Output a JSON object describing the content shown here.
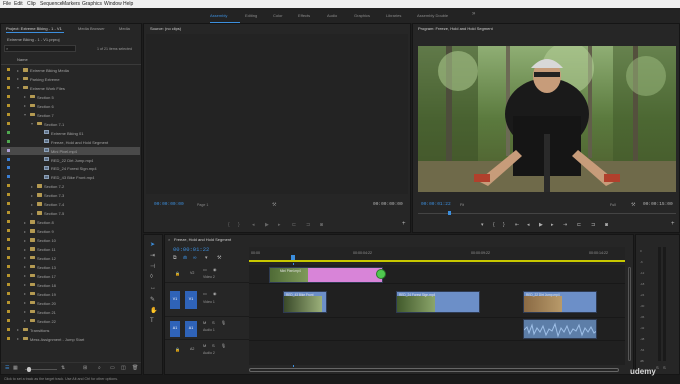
{
  "menu": [
    "File",
    "Edit",
    "Clip",
    "Sequence",
    "Markers",
    "Graphics",
    "Window",
    "Help"
  ],
  "workspaces": {
    "items": [
      "Assembly",
      "Editing",
      "Color",
      "Effects",
      "Audio",
      "Graphics",
      "Libraries",
      "Assembly Double"
    ],
    "active": "Assembly",
    "more": "»"
  },
  "project": {
    "tabs": [
      "Project: Extreme Biking - 1 - V1",
      "Media Browser",
      "Media"
    ],
    "name": "Extreme Biking - 1 - V1.prproj",
    "search_placeholder": "",
    "selection_info": "1 of 21 items selected",
    "column": "Name",
    "items": [
      {
        "label": "Extreme Biking Media",
        "type": "folder",
        "indent": 0,
        "color": "#b8962e",
        "twirl": "▸"
      },
      {
        "label": "Parking Extreme",
        "type": "folder",
        "indent": 0,
        "color": "#b8962e",
        "twirl": "▸"
      },
      {
        "label": "Extreme Work Files",
        "type": "folder",
        "indent": 0,
        "color": "#b8962e",
        "twirl": "▾"
      },
      {
        "label": "Section 5",
        "type": "folder",
        "indent": 1,
        "color": "#b8962e",
        "twirl": "▸"
      },
      {
        "label": "Section 6",
        "type": "folder",
        "indent": 1,
        "color": "#b8962e",
        "twirl": "▸"
      },
      {
        "label": "Section 7",
        "type": "folder",
        "indent": 1,
        "color": "#b8962e",
        "twirl": "▾"
      },
      {
        "label": "Section 7-1",
        "type": "folder",
        "indent": 2,
        "color": "#b8962e",
        "twirl": "▾"
      },
      {
        "label": "Extreme Biking 01",
        "type": "sequence",
        "indent": 3,
        "color": "#4fa84f",
        "twirl": ""
      },
      {
        "label": "Freeze, Hold and Hold Segment",
        "type": "sequence",
        "indent": 3,
        "color": "#4fa84f",
        "twirl": ""
      },
      {
        "label": "Mini Pixel.mp4",
        "type": "clip",
        "indent": 3,
        "color": "#b0a0d8",
        "twirl": "",
        "selected": true
      },
      {
        "label": "RED_22 Dirt Jump.mp4",
        "type": "clip",
        "indent": 3,
        "color": "#3b7fd4",
        "twirl": ""
      },
      {
        "label": "RED_24 Forest Sign.mp4",
        "type": "clip",
        "indent": 3,
        "color": "#3b7fd4",
        "twirl": ""
      },
      {
        "label": "RED_43 Bike Front.mp4",
        "type": "clip",
        "indent": 3,
        "color": "#3b7fd4",
        "twirl": ""
      },
      {
        "label": "Section 7-2",
        "type": "folder",
        "indent": 2,
        "color": "#b8962e",
        "twirl": "▸"
      },
      {
        "label": "Section 7-3",
        "type": "folder",
        "indent": 2,
        "color": "#b8962e",
        "twirl": "▸"
      },
      {
        "label": "Section 7-4",
        "type": "folder",
        "indent": 2,
        "color": "#b8962e",
        "twirl": "▸"
      },
      {
        "label": "Section 7-5",
        "type": "folder",
        "indent": 2,
        "color": "#b8962e",
        "twirl": "▸"
      },
      {
        "label": "Section 8",
        "type": "folder",
        "indent": 1,
        "color": "#b8962e",
        "twirl": "▸"
      },
      {
        "label": "Section 9",
        "type": "folder",
        "indent": 1,
        "color": "#b8962e",
        "twirl": "▸"
      },
      {
        "label": "Section 10",
        "type": "folder",
        "indent": 1,
        "color": "#b8962e",
        "twirl": "▸"
      },
      {
        "label": "Section 11",
        "type": "folder",
        "indent": 1,
        "color": "#b8962e",
        "twirl": "▸"
      },
      {
        "label": "Section 12",
        "type": "folder",
        "indent": 1,
        "color": "#b8962e",
        "twirl": "▸"
      },
      {
        "label": "Section 13",
        "type": "folder",
        "indent": 1,
        "color": "#b8962e",
        "twirl": "▸"
      },
      {
        "label": "Section 17",
        "type": "folder",
        "indent": 1,
        "color": "#b8962e",
        "twirl": "▸"
      },
      {
        "label": "Section 18",
        "type": "folder",
        "indent": 1,
        "color": "#b8962e",
        "twirl": "▸"
      },
      {
        "label": "Section 19",
        "type": "folder",
        "indent": 1,
        "color": "#b8962e",
        "twirl": "▸"
      },
      {
        "label": "Section 20",
        "type": "folder",
        "indent": 1,
        "color": "#b8962e",
        "twirl": "▸"
      },
      {
        "label": "Section 21",
        "type": "folder",
        "indent": 1,
        "color": "#b8962e",
        "twirl": "▸"
      },
      {
        "label": "Section 22",
        "type": "folder",
        "indent": 1,
        "color": "#b8962e",
        "twirl": "▸"
      },
      {
        "label": "Transitions",
        "type": "folder",
        "indent": 0,
        "color": "#b8962e",
        "twirl": "▸"
      },
      {
        "label": "Mess Assignment - Jump Start",
        "type": "folder",
        "indent": 0,
        "color": "#b8962e",
        "twirl": "▸"
      }
    ]
  },
  "source": {
    "tab": "Source: (no clips)",
    "tc_left": "00:00:00:00",
    "page": "Page 1",
    "tc_right": "00:00:00:00"
  },
  "program": {
    "tab": "Program: Freeze, Hold and Hold Segment",
    "tc_left": "00:00:01:22",
    "fit": "Fit",
    "quality": "Full",
    "tc_right": "00:00:15:00"
  },
  "timeline": {
    "tab": "Freeze, Hold and Hold Segment",
    "timecode": "00:00:01:22",
    "ruler": [
      "00:00",
      "00:00:04:22",
      "00:00:09:22",
      "00:00:14:22"
    ],
    "tracks": [
      {
        "id": "V2",
        "name": "Video 2",
        "kind": "video"
      },
      {
        "id": "V1",
        "name": "Video 1",
        "kind": "video"
      },
      {
        "id": "A1",
        "name": "Audio 1",
        "kind": "audio"
      },
      {
        "id": "A2",
        "name": "Audio 2",
        "kind": "audio"
      }
    ],
    "clips": [
      {
        "name": "Mini Pixel.mp4",
        "track": "V2",
        "color": "#d884d8"
      },
      {
        "name": "RED_43 Bike Front",
        "track": "V1",
        "color": "#6c8fc8"
      },
      {
        "name": "RED_24 Forest Sign.mp4",
        "track": "V1",
        "color": "#6c8fc8"
      },
      {
        "name": "RED_22 Dirt Jump.mp4",
        "track": "V1",
        "color": "#6c8fc8"
      }
    ],
    "meter_labels": [
      "0",
      "-6",
      "-12",
      "-18",
      "-24",
      "-30",
      "-36",
      "-42",
      "-48",
      "-54",
      "dB"
    ]
  },
  "status": "Click to set a track as the target track. Use Alt and Ctrl for other options.",
  "watermark": "udemy"
}
